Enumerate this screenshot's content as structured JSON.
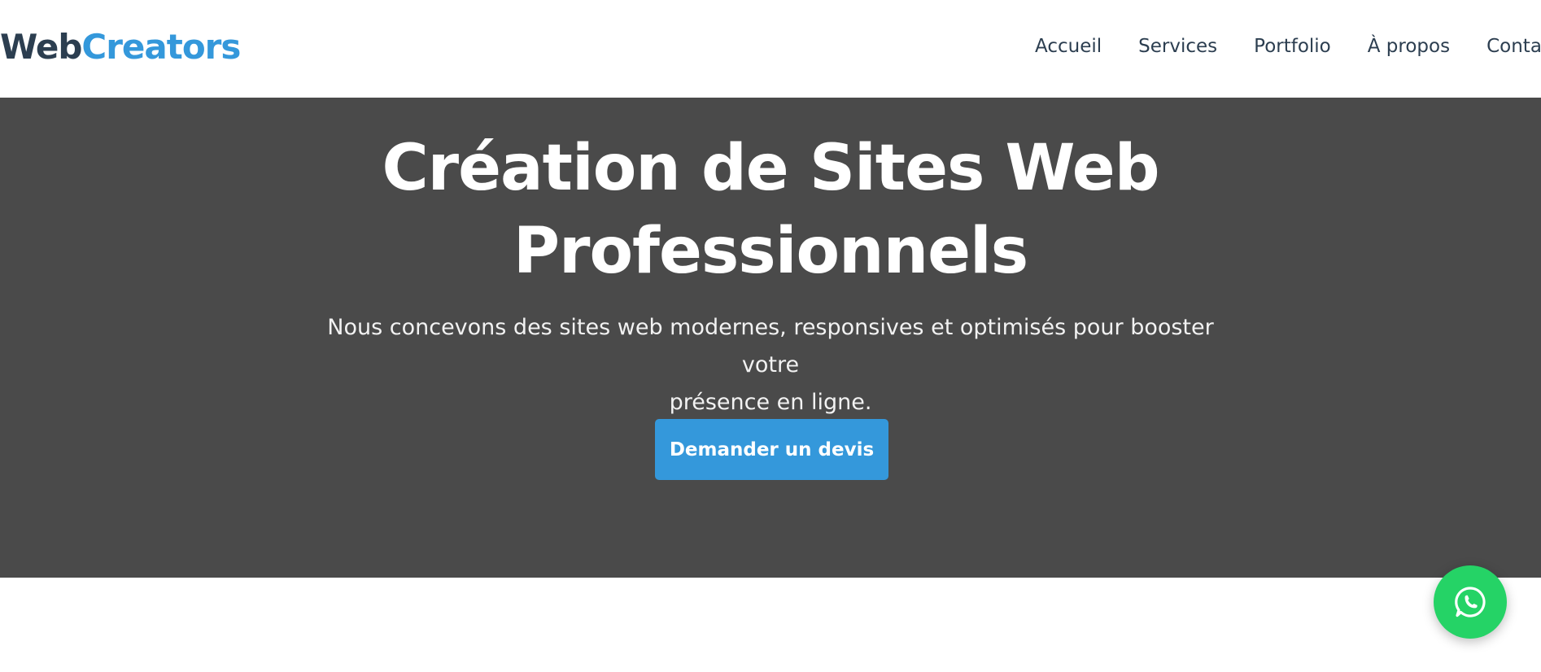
{
  "header": {
    "logo": {
      "part1": "Web",
      "part2": "Creators"
    },
    "nav": [
      {
        "label": "Accueil"
      },
      {
        "label": "Services"
      },
      {
        "label": "Portfolio"
      },
      {
        "label": "À propos"
      },
      {
        "label": "Contact"
      }
    ]
  },
  "hero": {
    "title_line1": "Création de Sites Web",
    "title_line2": "Professionnels",
    "subtitle_line1": "Nous concevons des sites web modernes, responsives et optimisés pour booster votre",
    "subtitle_line2": "présence en ligne.",
    "cta_label": "Demander un devis"
  },
  "floating": {
    "icon": "whatsapp-icon"
  },
  "colors": {
    "brand_dark": "#2c3e50",
    "brand_blue": "#3498db",
    "hero_bg": "#4a4a4a",
    "whatsapp_green": "#25d366"
  }
}
